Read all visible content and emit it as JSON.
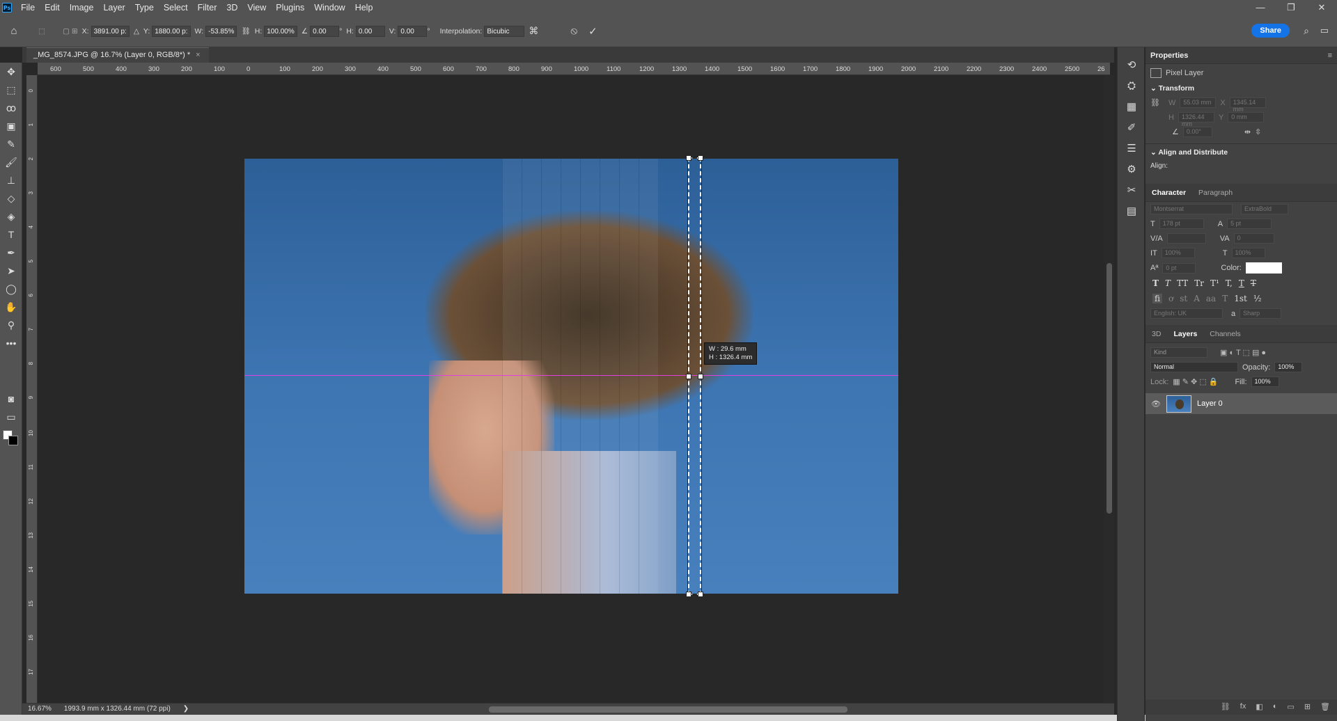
{
  "menu": {
    "logo": "Ps",
    "items": [
      "File",
      "Edit",
      "Image",
      "Layer",
      "Type",
      "Select",
      "Filter",
      "3D",
      "View",
      "Plugins",
      "Window",
      "Help"
    ]
  },
  "window_controls": {
    "minimize": "—",
    "restore": "❐",
    "close": "✕"
  },
  "options": {
    "x_label": "X:",
    "x_value": "3891.00 p:",
    "y_label": "Y:",
    "y_value": "1880.00 p:",
    "w_label": "W:",
    "w_value": "-53.85%",
    "h_label": "H:",
    "h_value": "100.00%",
    "angle_value": "0.00",
    "degree": "°",
    "hskew_label": "H:",
    "hskew_value": "0.00",
    "vskew_label": "V:",
    "vskew_value": "0.00",
    "interp_label": "Interpolation:",
    "interp_value": "Bicubic",
    "cancel_icon": "⦸",
    "commit_icon": "✓",
    "share_label": "Share"
  },
  "document": {
    "tab_title": "_MG_8574.JPG @ 16.7% (Layer 0, RGB/8*) *",
    "tab_close": "×",
    "ruler_ticks": [
      "600",
      "500",
      "400",
      "300",
      "200",
      "100",
      "0",
      "100",
      "200",
      "300",
      "400",
      "500",
      "600",
      "700",
      "800",
      "900",
      "1000",
      "1100",
      "1200",
      "1300",
      "1400",
      "1500",
      "1600",
      "1700",
      "1800",
      "1900",
      "2000",
      "2100",
      "2200",
      "2300",
      "2400",
      "2500",
      "26"
    ],
    "vruler_ticks": [
      "0",
      "1",
      "2",
      "3",
      "4",
      "5",
      "6",
      "7",
      "8",
      "9",
      "10",
      "11",
      "12",
      "13",
      "14",
      "15",
      "16",
      "17",
      "18"
    ],
    "tooltip_w": "W :      29.6 mm",
    "tooltip_h": "H :   1326.4 mm"
  },
  "status": {
    "zoom": "16.67%",
    "doc_size": "1993.9 mm x 1326.44 mm (72 ppi)",
    "arrow": "❯"
  },
  "properties": {
    "title": "Properties",
    "layer_type": "Pixel Layer",
    "transform_title": "Transform",
    "w_ph": "55.03 mm",
    "x_ph": "1345.14 mm",
    "h_ph": "1326.44 mm",
    "y_ph": "0 mm",
    "angle_ph": "0.00°",
    "align_title": "Align and Distribute",
    "align_label": "Align:"
  },
  "character": {
    "tab1": "Character",
    "tab2": "Paragraph",
    "font": "Montserrat",
    "style": "ExtraBold",
    "size": "178 pt",
    "leading": "5 pt",
    "tracking": "0",
    "vscale": "100%",
    "hscale": "100%",
    "baseline": "0 pt",
    "color_label": "Color:",
    "glyphs1": [
      "T",
      "T",
      "TT",
      "Tr",
      "T¹",
      "T,",
      "T",
      "T"
    ],
    "glyphs2": [
      "fi",
      "ơ",
      "st",
      "A",
      "aa",
      "T",
      "1st",
      "½"
    ],
    "lang": "English: UK",
    "aa_label": "a",
    "aa": "Sharp"
  },
  "layers": {
    "tabs": [
      "3D",
      "Layers",
      "Channels"
    ],
    "filter": "Kind",
    "blend": "Normal",
    "opacity_label": "Opacity:",
    "opacity": "100%",
    "lock_label": "Lock:",
    "fill_label": "Fill:",
    "fill": "100%",
    "layer_name": "Layer 0"
  }
}
